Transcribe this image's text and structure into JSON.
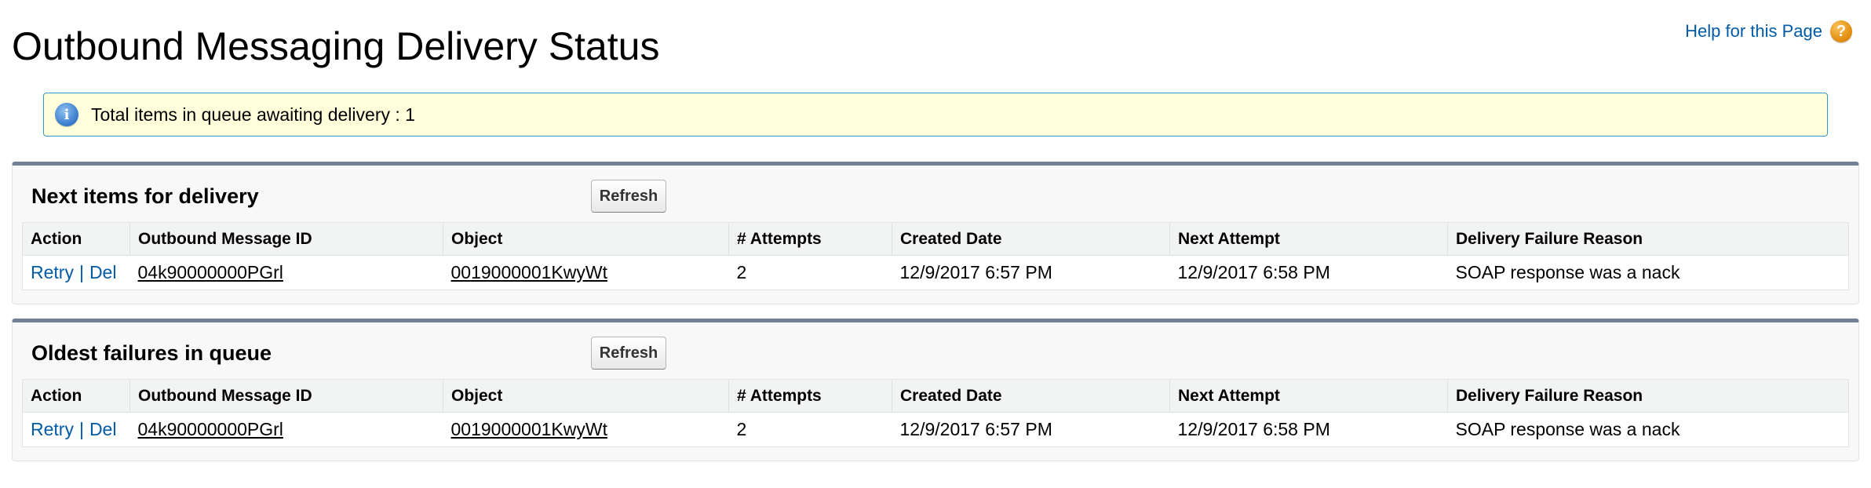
{
  "page": {
    "title": "Outbound Messaging Delivery Status",
    "help_label": "Help for this Page",
    "help_icon": "question-icon"
  },
  "info": {
    "icon": "info-icon",
    "text": "Total items in queue awaiting delivery : 1"
  },
  "columns": [
    "Action",
    "Outbound Message ID",
    "Object",
    "# Attempts",
    "Created Date",
    "Next Attempt",
    "Delivery Failure Reason"
  ],
  "sections": [
    {
      "title": "Next items for delivery",
      "refresh_label": "Refresh",
      "rows": [
        {
          "retry_label": "Retry",
          "separator": "|",
          "del_label": "Del",
          "message_id": "04k90000000PGrl",
          "object": "0019000001KwyWt",
          "attempts": "2",
          "created_date": "12/9/2017 6:57 PM",
          "next_attempt": "12/9/2017 6:58 PM",
          "failure_reason": "SOAP response was a nack"
        }
      ]
    },
    {
      "title": "Oldest failures in queue",
      "refresh_label": "Refresh",
      "rows": [
        {
          "retry_label": "Retry",
          "separator": "|",
          "del_label": "Del",
          "message_id": "04k90000000PGrl",
          "object": "0019000001KwyWt",
          "attempts": "2",
          "created_date": "12/9/2017 6:57 PM",
          "next_attempt": "12/9/2017 6:58 PM",
          "failure_reason": "SOAP response was a nack"
        }
      ]
    }
  ],
  "colors": {
    "link": "#015ba7",
    "banner_background": "#ffffdc",
    "banner_border": "#3399cc",
    "section_top_border": "#747e96"
  }
}
